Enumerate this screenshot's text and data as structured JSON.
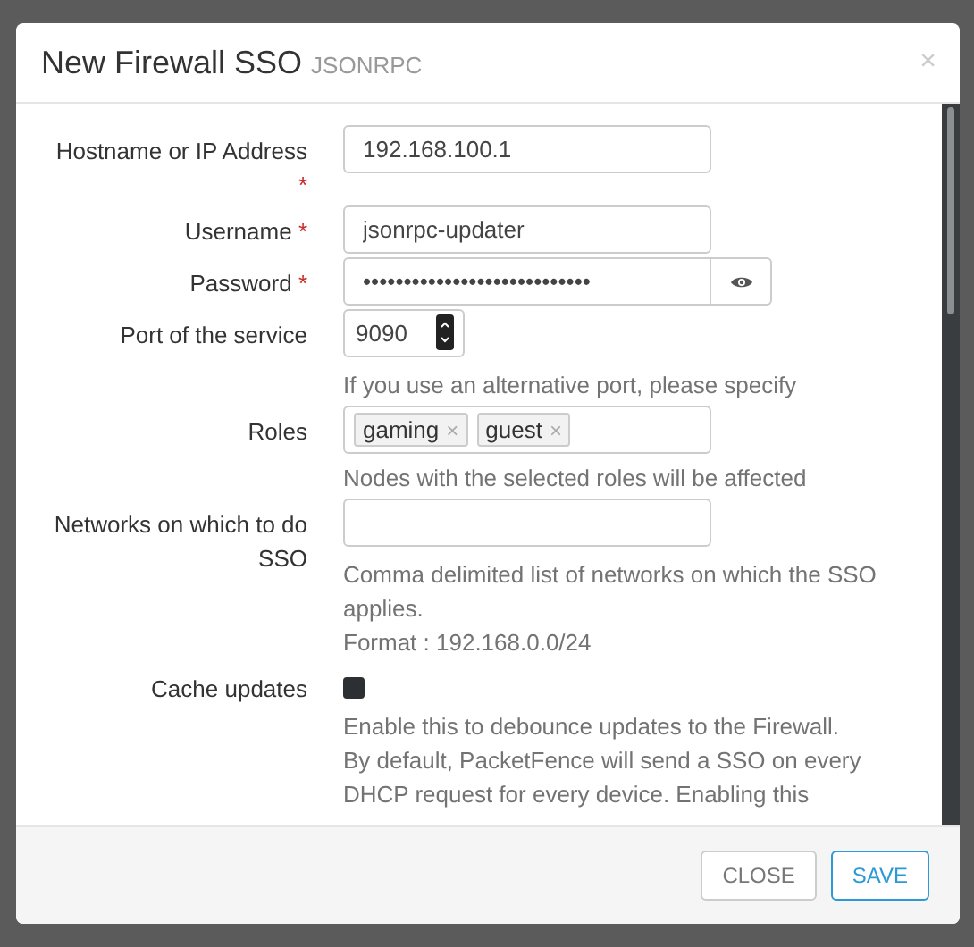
{
  "dialog": {
    "title": "New Firewall SSO",
    "subtitle": "JSONRPC",
    "close_icon": "×"
  },
  "fields": [
    {
      "kind": "text",
      "label": "Hostname or IP Address",
      "required_mark": "*",
      "value": "192.168.100.1"
    },
    {
      "kind": "text",
      "label": "Username",
      "required_mark": "*",
      "value": "jsonrpc-updater"
    },
    {
      "kind": "password",
      "label": "Password",
      "required_mark": "*",
      "value": "••••••••••••••••••••••••••••"
    },
    {
      "kind": "number",
      "label": "Port of the service",
      "value": "9090",
      "help": [
        "If you use an alternative port, please specify"
      ]
    },
    {
      "kind": "tags",
      "label": "Roles",
      "tags": [
        {
          "label": "gaming",
          "remove": "×"
        },
        {
          "label": "guest",
          "remove": "×"
        }
      ],
      "help": [
        "Nodes with the selected roles will be affected"
      ]
    },
    {
      "kind": "text",
      "label": "Networks on which to do SSO",
      "help": [
        "Comma delimited list of networks on which the SSO applies.",
        "Format : 192.168.0.0/24"
      ]
    },
    {
      "kind": "checkbox",
      "label": "Cache updates",
      "checked": false,
      "help": [
        "Enable this to debounce updates to the Firewall.",
        "By default, PacketFence will send a SSO on every DHCP request for every device. Enabling this"
      ]
    }
  ],
  "buttons": [
    {
      "label": "CLOSE",
      "primary": false
    },
    {
      "label": "SAVE",
      "primary": true
    }
  ]
}
